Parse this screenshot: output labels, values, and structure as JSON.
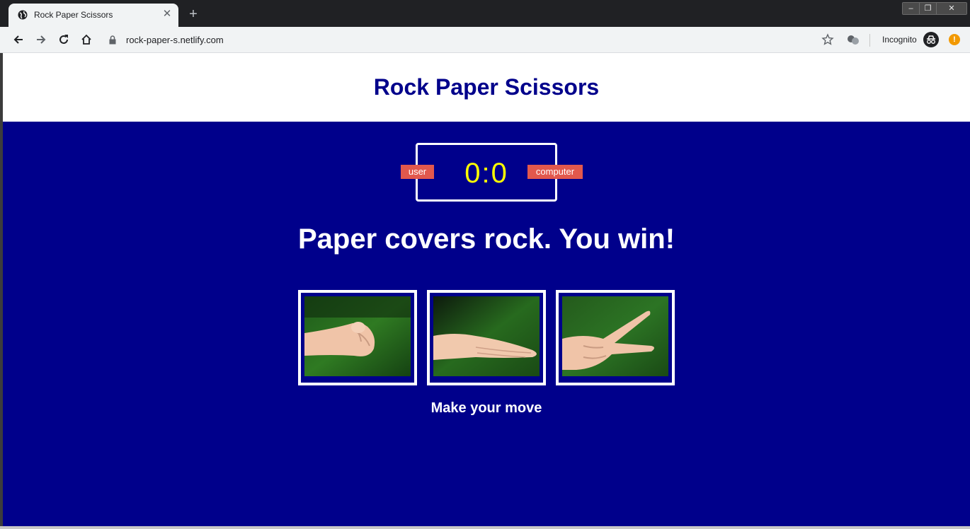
{
  "browser": {
    "tab_title": "Rock Paper Scissors",
    "url": "rock-paper-s.netlify.com",
    "incognito_label": "Incognito",
    "menu_alert": "!"
  },
  "page": {
    "header_title": "Rock Paper Scissors",
    "score": {
      "user_label": "user",
      "computer_label": "computer",
      "user_score": "0",
      "separator": ":",
      "computer_score": "0"
    },
    "result_message": "Paper covers rock. You win!",
    "choices": [
      {
        "name": "rock"
      },
      {
        "name": "paper"
      },
      {
        "name": "scissors"
      }
    ],
    "prompt": "Make your move"
  },
  "colors": {
    "main_bg": "#00008b",
    "title": "#00008b",
    "score_text": "#ffff00",
    "badge": "#e2584d"
  }
}
